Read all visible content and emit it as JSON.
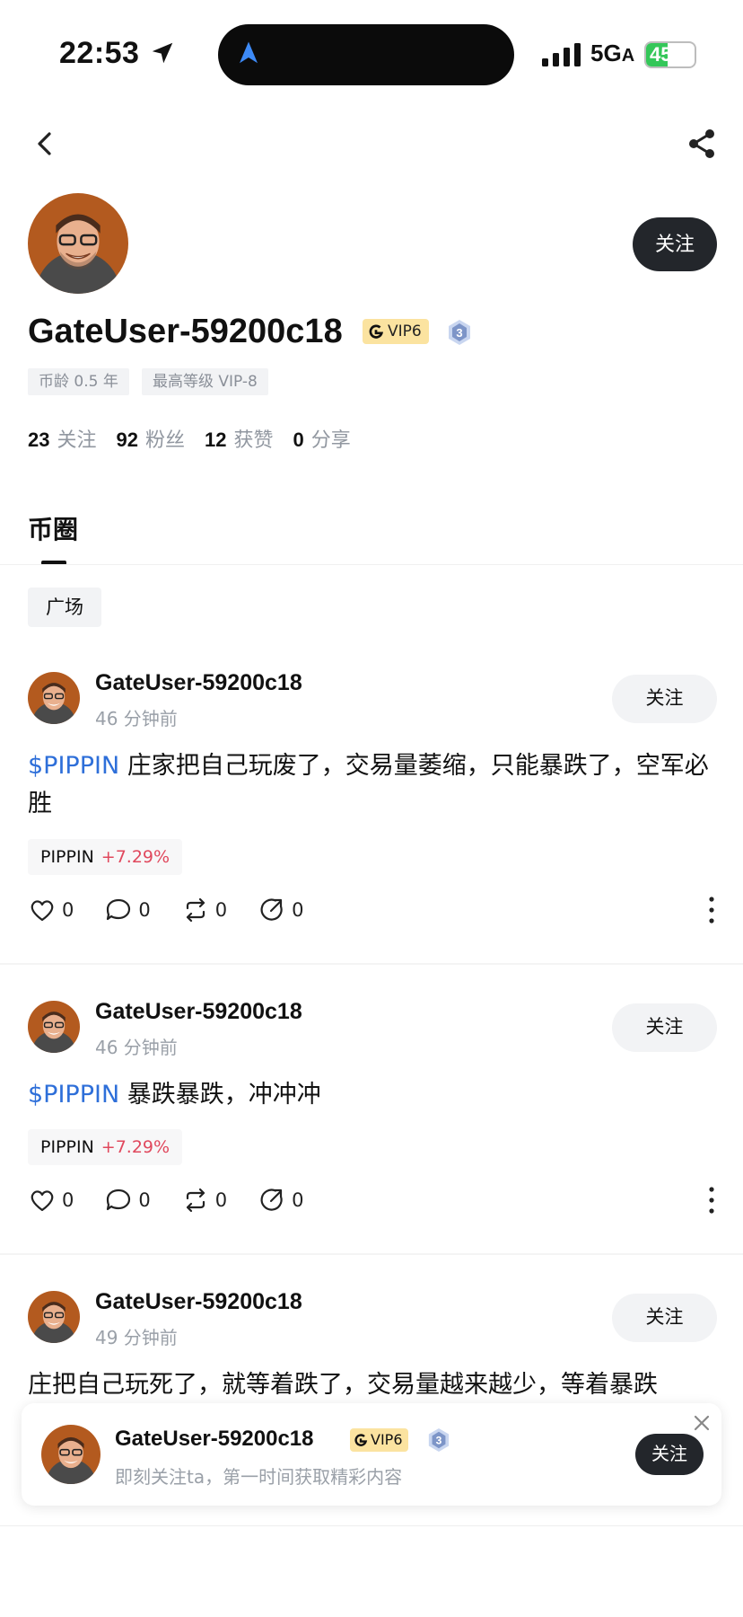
{
  "status_bar": {
    "time": "22:53",
    "network": "5G",
    "network_suffix": "A",
    "battery": "45"
  },
  "profile": {
    "username": "GateUser-59200c18",
    "vip": "VIP6",
    "level": "3",
    "follow_label": "关注",
    "tags": [
      "币龄 0.5 年",
      "最高等级 VIP-8"
    ],
    "stats": [
      {
        "num": "23",
        "label": "关注"
      },
      {
        "num": "92",
        "label": "粉丝"
      },
      {
        "num": "12",
        "label": "获赞"
      },
      {
        "num": "0",
        "label": "分享"
      }
    ]
  },
  "tabs": {
    "active": "币圈"
  },
  "filter_chip": "广场",
  "posts": [
    {
      "name": "GateUser-59200c18",
      "time": "46 分钟前",
      "follow": "关注",
      "ticker": "$PIPPIN",
      "text": " 庄家把自己玩废了，交易量萎缩，只能暴跌了，空军必胜",
      "coin": "PIPPIN",
      "change": "+7.29%",
      "likes": "0",
      "comments": "0",
      "reposts": "0",
      "shares": "0"
    },
    {
      "name": "GateUser-59200c18",
      "time": "46 分钟前",
      "follow": "关注",
      "ticker": "$PIPPIN",
      "text": " 暴跌暴跌，冲冲冲",
      "coin": "PIPPIN",
      "change": "+7.29%",
      "likes": "0",
      "comments": "0",
      "reposts": "0",
      "shares": "0"
    },
    {
      "name": "GateUser-59200c18",
      "time": "49 分钟前",
      "follow": "关注",
      "text": "庄把自己玩死了，就等着跌了，交易量越来越少，等着暴跌"
    }
  ],
  "follow_card": {
    "name": "GateUser-59200c18",
    "vip": "VIP6",
    "level": "3",
    "subtitle": "即刻关注ta，第一时间获取精彩内容",
    "follow": "关注"
  },
  "colors": {
    "accent_blue": "#2e6fd9",
    "positive_red": "#e0485d",
    "dark_button": "#23262b",
    "vip_gold": "#fbe3a0"
  }
}
